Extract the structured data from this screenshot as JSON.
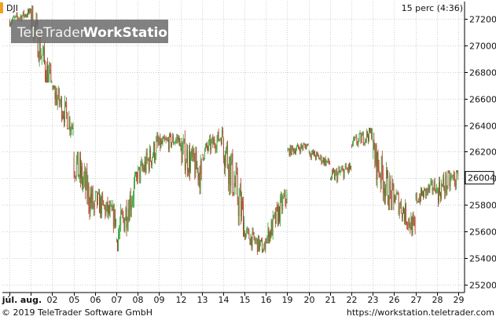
{
  "symbol": "DJI",
  "interval_label": "15 perc (4:36)",
  "watermark": {
    "part1": "TeleTrader",
    "part2": "WorkStation"
  },
  "footer": {
    "copyright": "© 2019 TeleTrader Software GmbH",
    "website": "https://workstation.teletrader.com"
  },
  "colors": {
    "up": "#2e9e2e",
    "down": "#b5301f",
    "accent": "#f0a020",
    "grid": "#cfcfcf",
    "interval": "#1f9a1f"
  },
  "chart_data": {
    "type": "line",
    "style": "candlestick",
    "ylim": [
      25140,
      27330
    ],
    "y_ticks": [
      25200,
      25400,
      25600,
      25800,
      26000,
      26200,
      26400,
      26600,
      26800,
      27000,
      27200
    ],
    "x_tick_labels": [
      "júl.",
      "aug.",
      "02",
      "05",
      "06",
      "07",
      "08",
      "09",
      "12",
      "13",
      "14",
      "15",
      "16",
      "19",
      "20",
      "21",
      "22",
      "23",
      "26",
      "27",
      "28",
      "29"
    ],
    "last_price": "26004",
    "grid": true,
    "series": [
      {
        "x": [
          "júl.",
          "aug.",
          "02",
          "05",
          "06",
          "07",
          "08",
          "09",
          "12",
          "13",
          "14",
          "15",
          "16",
          "19",
          "20",
          "21",
          "22",
          "23",
          "26",
          "27",
          "28"
        ],
        "open": [
          27180,
          27250,
          26680,
          26150,
          25840,
          25520,
          26000,
          26250,
          26220,
          26180,
          26300,
          25590,
          25520,
          26200,
          26200,
          26000,
          26250,
          26200,
          25880,
          25840,
          25900
        ],
        "close": [
          27250,
          26650,
          26380,
          25770,
          25690,
          26000,
          26260,
          26300,
          26030,
          26330,
          25670,
          25460,
          25880,
          26250,
          26110,
          26080,
          26350,
          25800,
          25600,
          25950,
          26020
        ],
        "high": [
          27280,
          27300,
          26700,
          26200,
          25950,
          26050,
          26390,
          26420,
          26400,
          26420,
          26330,
          25650,
          25920,
          26280,
          26220,
          26200,
          26380,
          26370,
          25920,
          26050,
          26060
        ],
        "low": [
          27120,
          26720,
          26270,
          25580,
          25560,
          25450,
          25960,
          26160,
          25850,
          26130,
          25560,
          25360,
          25510,
          26120,
          26050,
          25960,
          26150,
          25760,
          25520,
          25790,
          25650
        ]
      }
    ]
  }
}
